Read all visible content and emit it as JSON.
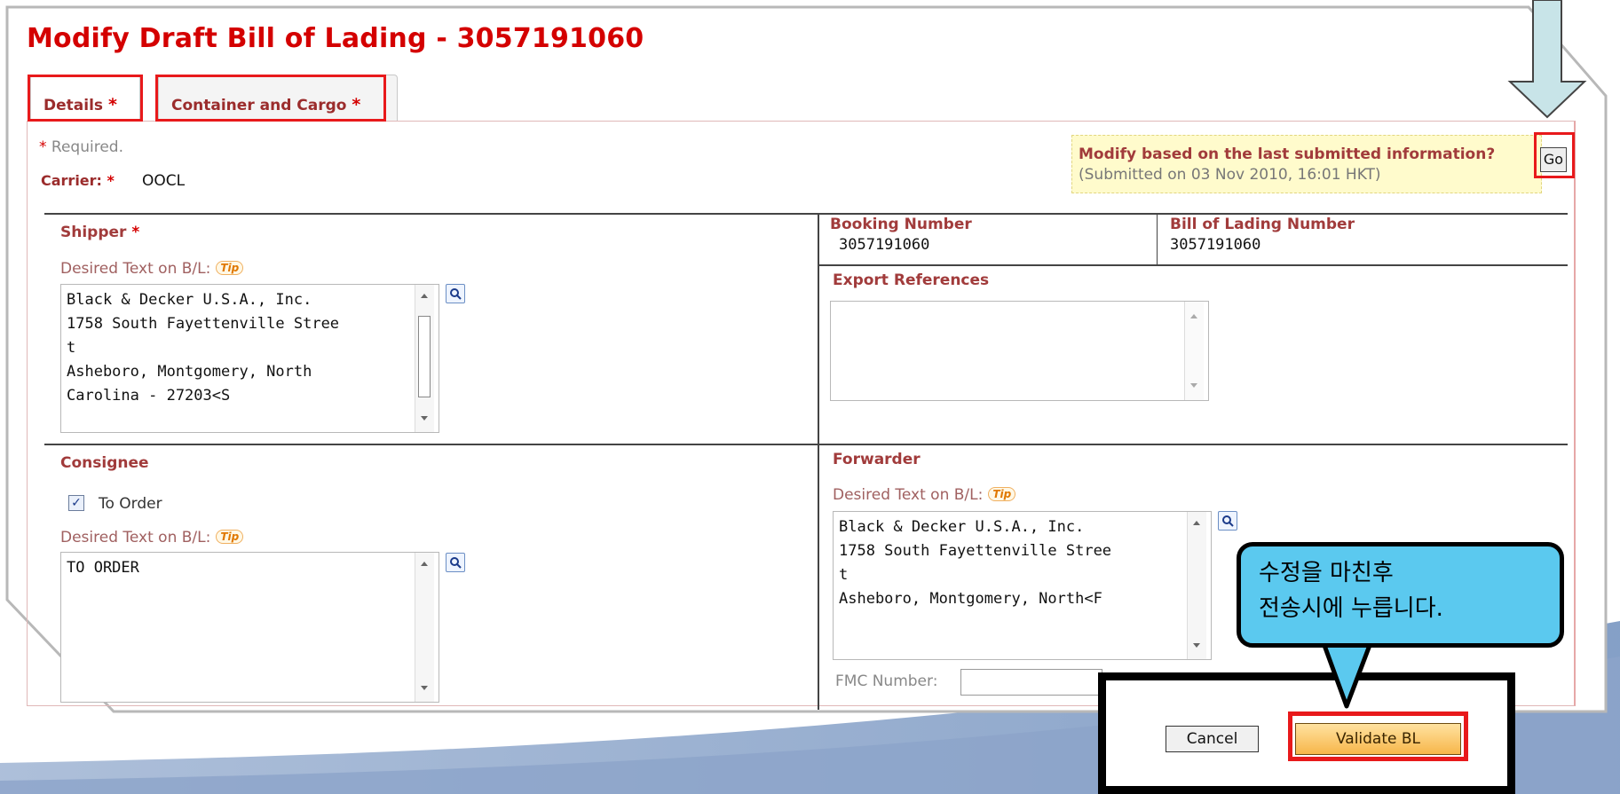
{
  "page": {
    "title": "Modify Draft Bill of Lading - 3057191060",
    "tabs": [
      {
        "label": "Details",
        "required_mark": "*"
      },
      {
        "label": "Container and Cargo",
        "required_mark": "*"
      }
    ],
    "required_note": {
      "mark": "*",
      "text": "Required."
    },
    "carrier": {
      "label": "Carrier:",
      "mark": "*",
      "value": "OOCL"
    },
    "notice": {
      "question": "Modify based on the last submitted information?",
      "submitted": "(Submitted on 03 Nov 2010, 16:01 HKT)",
      "go_label": "Go"
    }
  },
  "shipper": {
    "label": "Shipper",
    "mark": "*",
    "desired_text_label": "Desired Text on B/L:",
    "tip": "Tip",
    "text": "Black & Decker U.S.A., Inc.\n1758 South Fayettenville Stree\nt\nAsheboro, Montgomery, North\nCarolina - 27203<S"
  },
  "booking": {
    "label": "Booking Number",
    "value": "3057191060"
  },
  "bl_number": {
    "label": "Bill of Lading Number",
    "value": "3057191060"
  },
  "export_refs": {
    "label": "Export References",
    "text": ""
  },
  "consignee": {
    "label": "Consignee",
    "to_order_label": "To Order",
    "to_order_checked": true,
    "desired_text_label": "Desired Text on B/L:",
    "tip": "Tip",
    "text": "TO ORDER"
  },
  "forwarder": {
    "label": "Forwarder",
    "desired_text_label": "Desired Text on B/L:",
    "tip": "Tip",
    "text": "Black & Decker U.S.A., Inc.\n1758 South Fayettenville Stree\nt\nAsheboro, Montgomery, North<F",
    "fmc_label": "FMC Number:"
  },
  "actions": {
    "cancel": "Cancel",
    "validate": "Validate BL"
  },
  "callout": {
    "text": "수정을 마친후\n전송시에 누릅니다."
  },
  "colors": {
    "title_red": "#d40000",
    "highlight_red": "#e8191b",
    "callout_blue": "#5bc9ef",
    "notice_yellow": "#fffbcc",
    "arrow_fill": "#c8e4e8"
  }
}
